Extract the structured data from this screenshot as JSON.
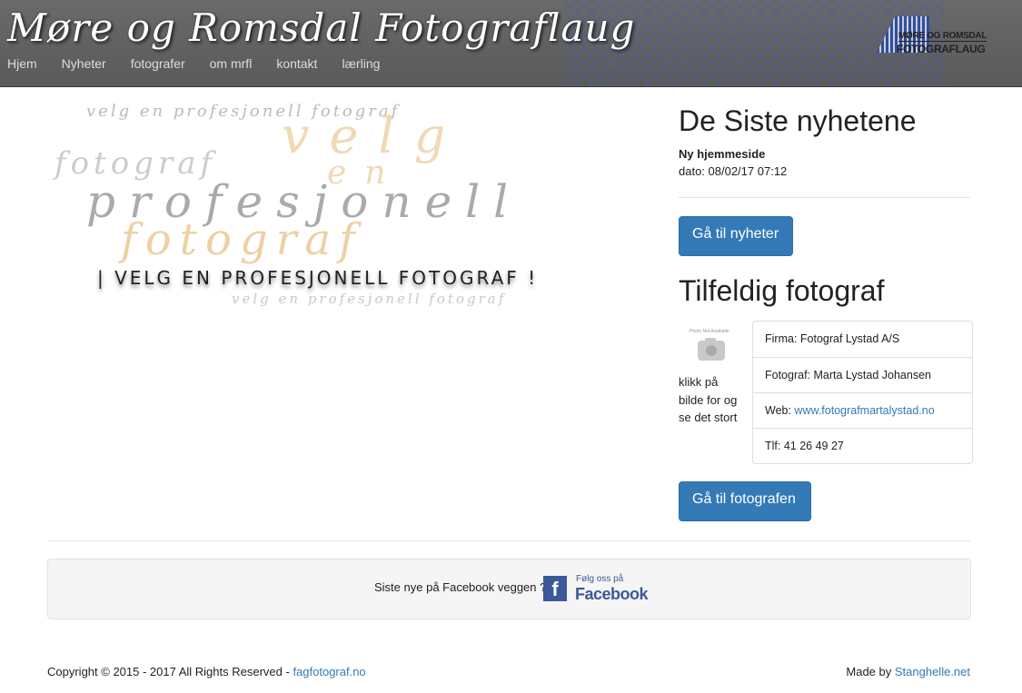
{
  "header": {
    "site_title": "Møre og Romsdal Fotograflaug",
    "nav": [
      "Hjem",
      "Nyheter",
      "fotografer",
      "om mrfl",
      "kontakt",
      "lærling"
    ],
    "logo_line1": "MØRE OG ROMSDAL",
    "logo_line2": "FOTOGRAFLAUG"
  },
  "hero": {
    "script_top": "velg en profesjonell fotograf",
    "velg": "velg",
    "fotograf_small": "fotograf",
    "en": "en",
    "profesjonell": "profesjonell",
    "fotograf_large": "fotograf",
    "caption": "| VELG EN PROFESJONELL FOTOGRAF !",
    "script_bottom": "velg en profesjonell fotograf"
  },
  "news": {
    "heading": "De Siste nyhetene",
    "item_title": "Ny hjemmeside",
    "item_date": "dato: 08/02/17 07:12",
    "button": "Gå til nyheter"
  },
  "random_photographer": {
    "heading": "Tilfeldig fotograf",
    "photo_placeholder": "Photo Not Available",
    "click_text": "klikk på bilde for og se det stort",
    "firma_label": "Firma: ",
    "firma": "Fotograf Lystad A/S",
    "fotograf_label": "Fotograf: ",
    "fotograf": "Marta Lystad Johansen",
    "web_label": "Web: ",
    "web": "www.fotografmartalystad.no",
    "tlf_label": "Tlf: ",
    "tlf": "41 26 49 27",
    "button": "Gå til fotografen"
  },
  "facebook": {
    "text": "Siste nye på Facebook veggen ?",
    "badge_small": "Følg oss på",
    "badge_big": "Facebook"
  },
  "footer": {
    "copyright": "Copyright © 2015 - 2017 All Rights Reserved - ",
    "copyright_link": "fagfotograf.no",
    "made_by": "Made by ",
    "made_by_link": "Stanghelle.net"
  }
}
